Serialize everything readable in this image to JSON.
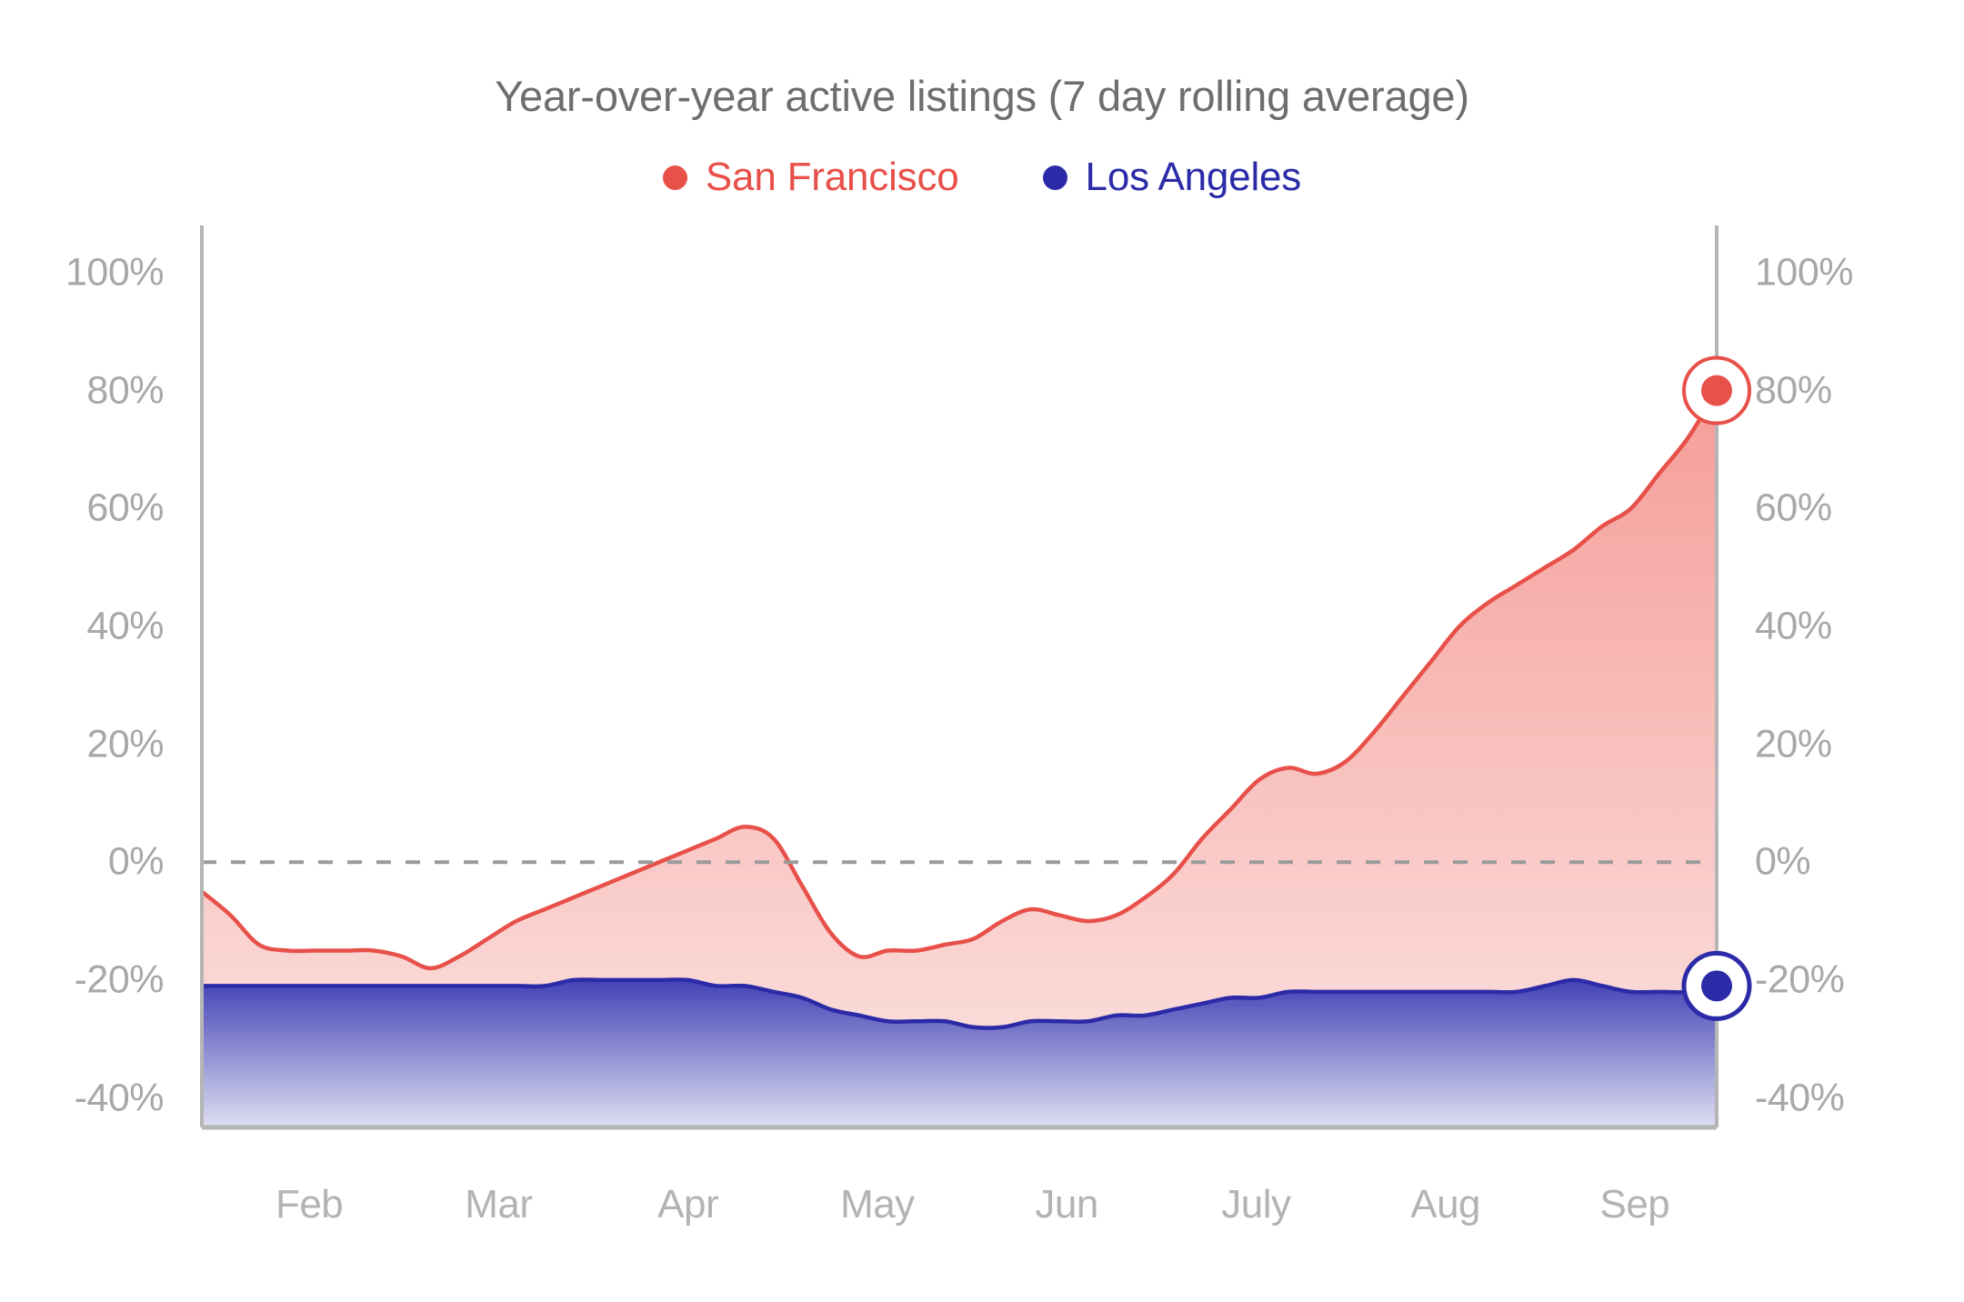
{
  "chart_data": {
    "type": "area",
    "title": "Year-over-year active listings (7 day rolling average)",
    "xlabel": "",
    "ylabel": "",
    "ylim": [
      -45,
      108
    ],
    "yticks": [
      100,
      80,
      60,
      40,
      20,
      0,
      -20,
      -40
    ],
    "ytick_labels": [
      "100%",
      "80%",
      "60%",
      "40%",
      "20%",
      "0%",
      "-20%",
      "-40%"
    ],
    "right_axis": true,
    "right_ytick_labels": [
      "100%",
      "80%",
      "60%",
      "40%",
      "20%",
      "0%",
      "-20%",
      "-40%"
    ],
    "grid": false,
    "zero_line": true,
    "legend_position": "top-center",
    "categories": [
      "Feb",
      "Mar",
      "Apr",
      "May",
      "Jun",
      "July",
      "Aug",
      "Sep"
    ],
    "xtick_labels": [
      "Feb",
      "Mar",
      "Apr",
      "May",
      "Jun",
      "July",
      "Aug",
      "Sep"
    ],
    "x": [
      0,
      0.5,
      1,
      1.5,
      2,
      2.5,
      3,
      3.5,
      4,
      4.5,
      5,
      5.5,
      6,
      6.5,
      7,
      7.5,
      8,
      8.5,
      9,
      9.5,
      10,
      10.5,
      11,
      11.5,
      12,
      12.5,
      13,
      13.5,
      14,
      14.5,
      15,
      15.5,
      16,
      16.5,
      17,
      17.5,
      18,
      18.5,
      19,
      19.5,
      20,
      20.5,
      21,
      21.5,
      22,
      22.5,
      23
    ],
    "series": [
      {
        "name": "San Francisco",
        "color": "#E8504A",
        "fill_top": "#F59A95",
        "fill_bottom": "#FBE4E2",
        "end_value": 80,
        "end_label": "80%",
        "values": [
          -5,
          -9,
          -14,
          -15,
          -15,
          -15,
          -15,
          -16,
          -18,
          -16,
          -13,
          -10,
          -8,
          -6,
          -4,
          -2,
          0,
          2,
          4,
          6,
          4,
          -4,
          -12,
          -16,
          -15,
          -15,
          -14,
          -13,
          -10,
          -8,
          -9,
          -10,
          -9,
          -6,
          -2,
          4,
          9,
          14,
          16,
          15,
          17,
          22,
          28,
          34,
          40,
          44,
          47
        ]
      },
      {
        "name": "Los Angeles",
        "color": "#2B2BA8",
        "fill_top": "#3C3CB4",
        "fill_bottom": "#DEDEF2",
        "end_value": -21,
        "end_label": "-20%",
        "values": [
          -21,
          -21,
          -21,
          -21,
          -21,
          -21,
          -21,
          -21,
          -21,
          -21,
          -21,
          -21,
          -21,
          -20,
          -20,
          -20,
          -20,
          -20,
          -21,
          -21,
          -22,
          -23,
          -25,
          -26,
          -27,
          -27,
          -27,
          -28,
          -28,
          -27,
          -27,
          -27,
          -26,
          -26,
          -25,
          -24,
          -23,
          -23,
          -22,
          -22,
          -22,
          -22,
          -22,
          -22,
          -22,
          -22,
          -22
        ]
      }
    ],
    "series_extended_note": "",
    "sf_full": [
      -5,
      -9,
      -14,
      -15,
      -15,
      -15,
      -15,
      -16,
      -18,
      -16,
      -13,
      -10,
      -8,
      -6,
      -4,
      -2,
      0,
      2,
      4,
      6,
      4,
      -4,
      -12,
      -16,
      -15,
      -15,
      -14,
      -13,
      -10,
      -8,
      -9,
      -10,
      -9,
      -6,
      -2,
      4,
      9,
      14,
      16,
      15,
      17,
      22,
      28,
      34,
      40,
      44,
      47,
      50,
      53,
      57,
      60,
      66,
      72,
      80
    ],
    "la_full": [
      -21,
      -21,
      -21,
      -21,
      -21,
      -21,
      -21,
      -21,
      -21,
      -21,
      -21,
      -21,
      -21,
      -20,
      -20,
      -20,
      -20,
      -20,
      -21,
      -21,
      -22,
      -23,
      -25,
      -26,
      -27,
      -27,
      -27,
      -28,
      -28,
      -27,
      -27,
      -27,
      -26,
      -26,
      -25,
      -24,
      -23,
      -23,
      -22,
      -22,
      -22,
      -22,
      -22,
      -22,
      -22,
      -22,
      -22,
      -21,
      -20,
      -21,
      -22,
      -22,
      -22,
      -21
    ]
  },
  "legend": [
    {
      "label": "San Francisco",
      "color": "#E8504A"
    },
    {
      "label": "Los Angeles",
      "color": "#2B2BA8"
    }
  ],
  "axes": {
    "y_left": [
      "100%",
      "80%",
      "60%",
      "40%",
      "20%",
      "0%",
      "-20%",
      "-40%"
    ],
    "y_right": [
      "100%",
      "80%",
      "60%",
      "40%",
      "20%",
      "0%",
      "-20%",
      "-40%"
    ],
    "x": [
      "Feb",
      "Mar",
      "Apr",
      "May",
      "Jun",
      "July",
      "Aug",
      "Sep"
    ]
  },
  "colors": {
    "sf": "#E8504A",
    "la": "#2B2BA8",
    "title": "#6e6e6e",
    "tick": "#a8a8a8",
    "axis_line": "#b5b5b5",
    "zero_line": "#9a9a9a"
  }
}
